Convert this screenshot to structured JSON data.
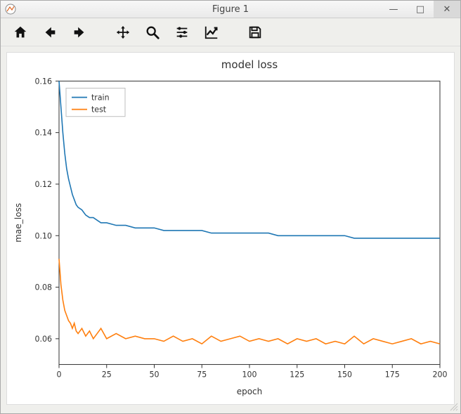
{
  "window": {
    "title": "Figure 1",
    "buttons": {
      "min": "—",
      "max": "□",
      "close": "✕"
    }
  },
  "toolbar": {
    "home": "Home",
    "back": "Back",
    "forward": "Forward",
    "pan": "Pan",
    "zoom": "Zoom",
    "configure": "Configure subplots",
    "edit": "Edit axis",
    "save": "Save"
  },
  "chart_data": {
    "type": "line",
    "title": "model loss",
    "xlabel": "epoch",
    "ylabel": "mae_loss",
    "xlim": [
      0,
      200
    ],
    "ylim": [
      0.05,
      0.16
    ],
    "xticks": [
      0,
      25,
      50,
      75,
      100,
      125,
      150,
      175,
      200
    ],
    "yticks": [
      0.06,
      0.08,
      0.1,
      0.12,
      0.14,
      0.16
    ],
    "legend": {
      "position": "upper left",
      "entries": [
        "train",
        "test"
      ]
    },
    "x": [
      0,
      1,
      2,
      3,
      4,
      5,
      6,
      7,
      8,
      9,
      10,
      12,
      14,
      16,
      18,
      20,
      22,
      25,
      30,
      35,
      40,
      45,
      50,
      55,
      60,
      65,
      70,
      75,
      80,
      85,
      90,
      95,
      100,
      105,
      110,
      115,
      120,
      125,
      130,
      135,
      140,
      145,
      150,
      155,
      160,
      165,
      170,
      175,
      180,
      185,
      190,
      195,
      200
    ],
    "series": [
      {
        "name": "train",
        "color": "#1f77b4",
        "values": [
          0.16,
          0.15,
          0.14,
          0.132,
          0.126,
          0.122,
          0.119,
          0.116,
          0.114,
          0.112,
          0.111,
          0.11,
          0.108,
          0.107,
          0.107,
          0.106,
          0.105,
          0.105,
          0.104,
          0.104,
          0.103,
          0.103,
          0.103,
          0.102,
          0.102,
          0.102,
          0.102,
          0.102,
          0.101,
          0.101,
          0.101,
          0.101,
          0.101,
          0.101,
          0.101,
          0.1,
          0.1,
          0.1,
          0.1,
          0.1,
          0.1,
          0.1,
          0.1,
          0.099,
          0.099,
          0.099,
          0.099,
          0.099,
          0.099,
          0.099,
          0.099,
          0.099,
          0.099
        ]
      },
      {
        "name": "test",
        "color": "#ff7f0e",
        "values": [
          0.091,
          0.081,
          0.075,
          0.071,
          0.069,
          0.067,
          0.066,
          0.064,
          0.066,
          0.063,
          0.062,
          0.064,
          0.061,
          0.063,
          0.06,
          0.062,
          0.064,
          0.06,
          0.062,
          0.06,
          0.061,
          0.06,
          0.06,
          0.059,
          0.061,
          0.059,
          0.06,
          0.058,
          0.061,
          0.059,
          0.06,
          0.061,
          0.059,
          0.06,
          0.059,
          0.06,
          0.058,
          0.06,
          0.059,
          0.06,
          0.058,
          0.059,
          0.058,
          0.061,
          0.058,
          0.06,
          0.059,
          0.058,
          0.059,
          0.06,
          0.058,
          0.059,
          0.058
        ]
      }
    ]
  }
}
